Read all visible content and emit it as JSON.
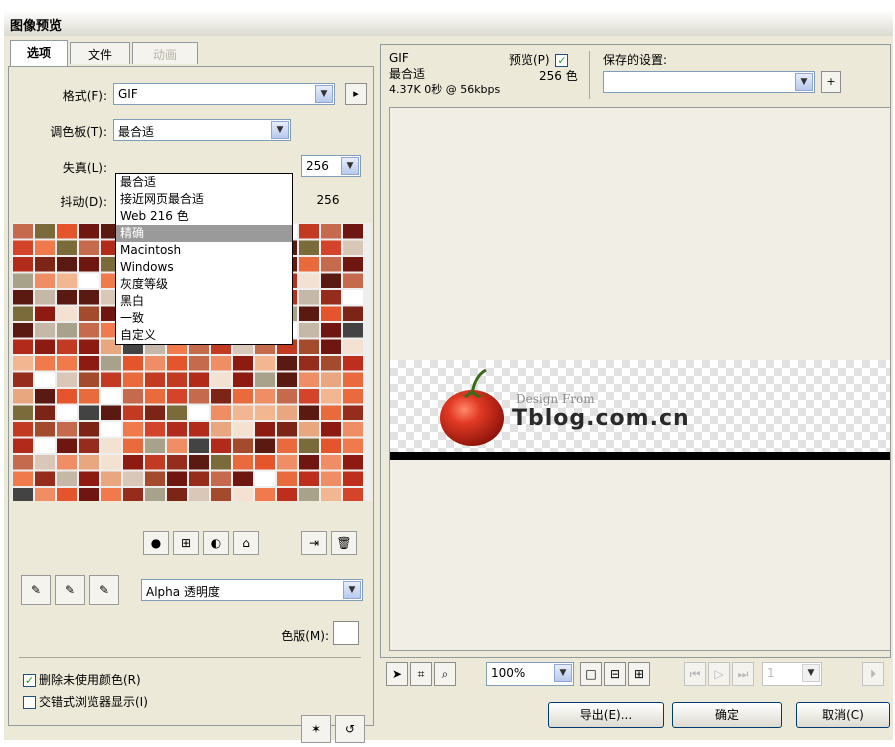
{
  "window": {
    "title": "图像预览"
  },
  "tabs": [
    {
      "label": "选项",
      "state": "active"
    },
    {
      "label": "文件",
      "state": "normal"
    },
    {
      "label": "动画",
      "state": "disabled"
    }
  ],
  "options": {
    "format_label": "格式(F):",
    "format_value": "GIF",
    "palette_label": "调色板(T):",
    "palette_value": "最合适",
    "palette_options": [
      "最合适",
      "接近网页最合适",
      "Web 216 色",
      "精确",
      "Macintosh",
      "Windows",
      "灰度等级",
      "黑白",
      "一致",
      "自定义"
    ],
    "palette_selected": "精确",
    "loss_label": "失真(L):",
    "dither_label": "抖动(D):",
    "colors_value": "256",
    "colors_count": "256",
    "alpha_value": "Alpha 透明度",
    "matte_label": "色版(M):",
    "remove_unused_label": "删除未使用颜色(R)",
    "remove_unused_checked": true,
    "interlaced_label": "交错式浏览器显示(I)",
    "interlaced_checked": false
  },
  "preview": {
    "format": "GIF",
    "palette": "最合适",
    "preview_label": "预览(P)",
    "preview_checked": true,
    "colors": "256 色",
    "stats": "4.37K 0秒 @ 56kbps",
    "saved_settings_label": "保存的设置:",
    "saved_settings_value": "",
    "logo_tagline": "Design From",
    "logo_text": "Tblog.com.cn"
  },
  "toolbar": {
    "zoom": "100%",
    "frame": "1"
  },
  "buttons": {
    "export": "导出(E)...",
    "ok": "确定",
    "cancel": "取消(C)"
  },
  "icons": {
    "dropdown": "chevron-down-icon",
    "arrow": "arrow-pointer-icon",
    "crop": "crop-icon",
    "zoom": "magnifier-icon",
    "eyedropper": "eyedropper-icon"
  },
  "colors": {
    "dialog_bg": "#ece9d8",
    "preview_bg": "#f1efe5",
    "tomato": "#d7281b",
    "check_green": "#21a121"
  }
}
